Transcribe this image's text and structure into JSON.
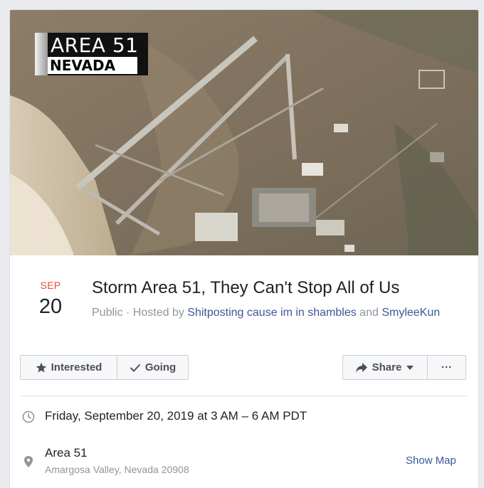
{
  "cover": {
    "badge_line1": "AREA 51",
    "badge_line2": "NEVADA"
  },
  "event": {
    "month": "SEP",
    "day": "20",
    "title": "Storm Area 51, They Can't Stop All of Us",
    "privacy": "Public",
    "hosted_by_prefix": " · Hosted by ",
    "host1": "Shitposting cause im in shambles",
    "and_text": " and ",
    "host2": "SmyleeKun"
  },
  "actions": {
    "interested_label": "Interested",
    "going_label": "Going",
    "share_label": "Share",
    "more_label": "···"
  },
  "details": {
    "time": "Friday, September 20, 2019 at 3 AM – 6 AM PDT",
    "location_name": "Area 51",
    "location_address": "Amargosa Valley, Nevada 20908",
    "show_map_label": "Show Map"
  },
  "colors": {
    "month": "#e74c3c",
    "link": "#385898",
    "muted_text": "#90949c",
    "button_bg": "#f6f7f9",
    "page_bg": "#e9ebee"
  },
  "icons": [
    "star-icon",
    "check-icon",
    "share-arrow-icon",
    "caret-down-icon",
    "more-icon",
    "clock-icon",
    "location-pin-icon"
  ]
}
